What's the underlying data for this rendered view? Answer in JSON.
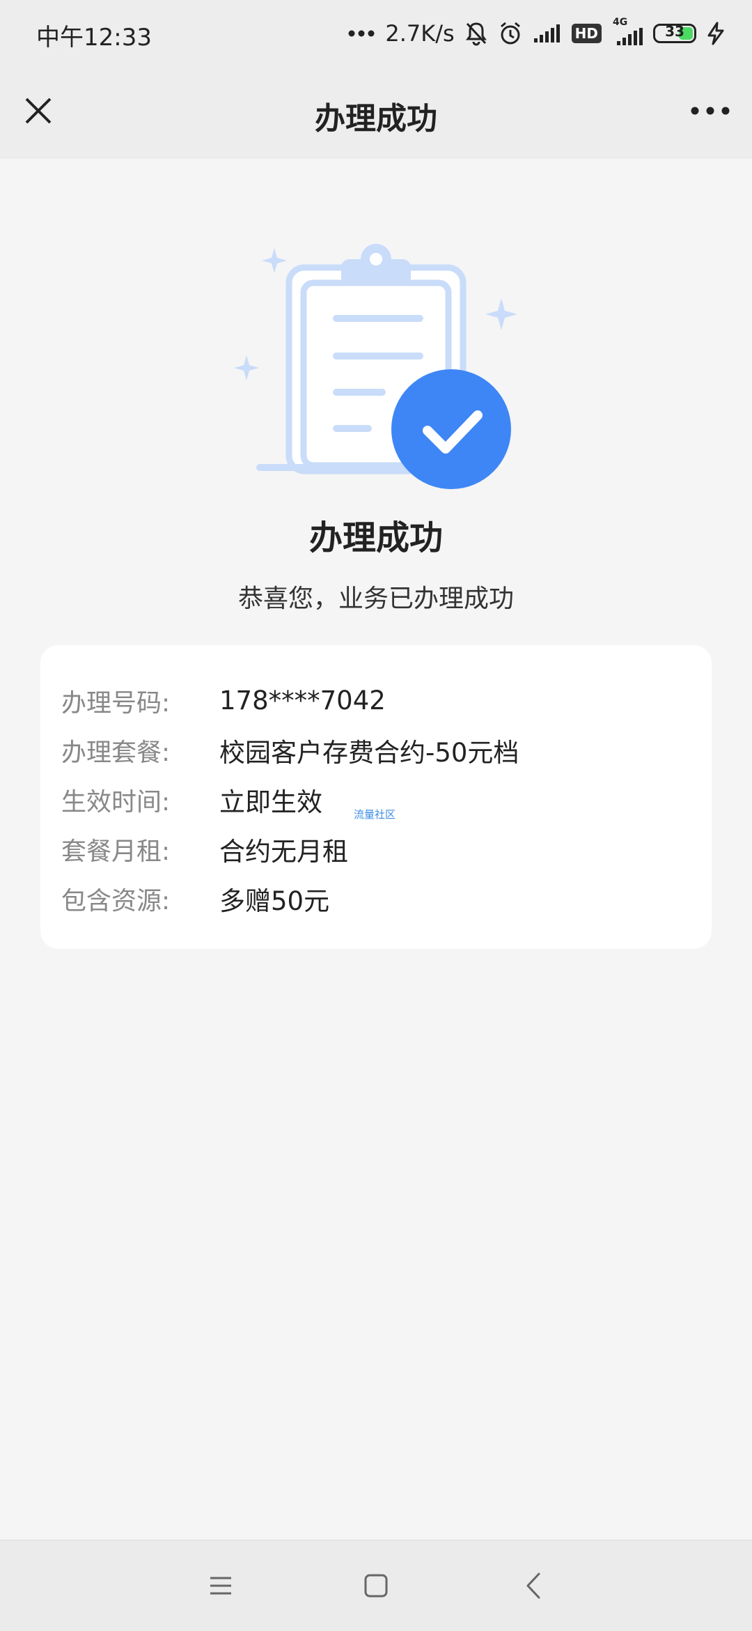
{
  "status_bar": {
    "time": "中午12:33",
    "network_speed": "2.7K/s",
    "hd_badge": "HD",
    "network_type": "4G",
    "battery_level": "33",
    "icons": [
      "more-dots-icon",
      "mute-bell-icon",
      "alarm-icon",
      "signal-icon",
      "hd-icon",
      "signal-4g-icon",
      "battery-icon",
      "charging-icon"
    ]
  },
  "navbar": {
    "title": "办理成功",
    "close_icon": "close-icon",
    "more_icon": "more-icon"
  },
  "hero": {
    "title": "办理成功",
    "subtitle": "恭喜您，业务已办理成功",
    "illustration_icon": "clipboard-check-icon"
  },
  "details": {
    "rows": [
      {
        "label": "办理号码:",
        "value": "178****7042"
      },
      {
        "label": "办理套餐:",
        "value": "校园客户存费合约-50元档"
      },
      {
        "label": "生效时间:",
        "value": "立即生效"
      },
      {
        "label": "套餐月租:",
        "value": "合约无月租"
      },
      {
        "label": "包含资源:",
        "value": "多赠50元"
      }
    ],
    "watermark": "流量社区"
  },
  "bottom_nav": {
    "icons": [
      "menu-icon",
      "home-square-icon",
      "back-icon"
    ]
  },
  "colors": {
    "accent": "#3e86f5",
    "illustration_light": "#c9dcf9",
    "background": "#f5f5f5",
    "bar_background": "#ededed"
  }
}
